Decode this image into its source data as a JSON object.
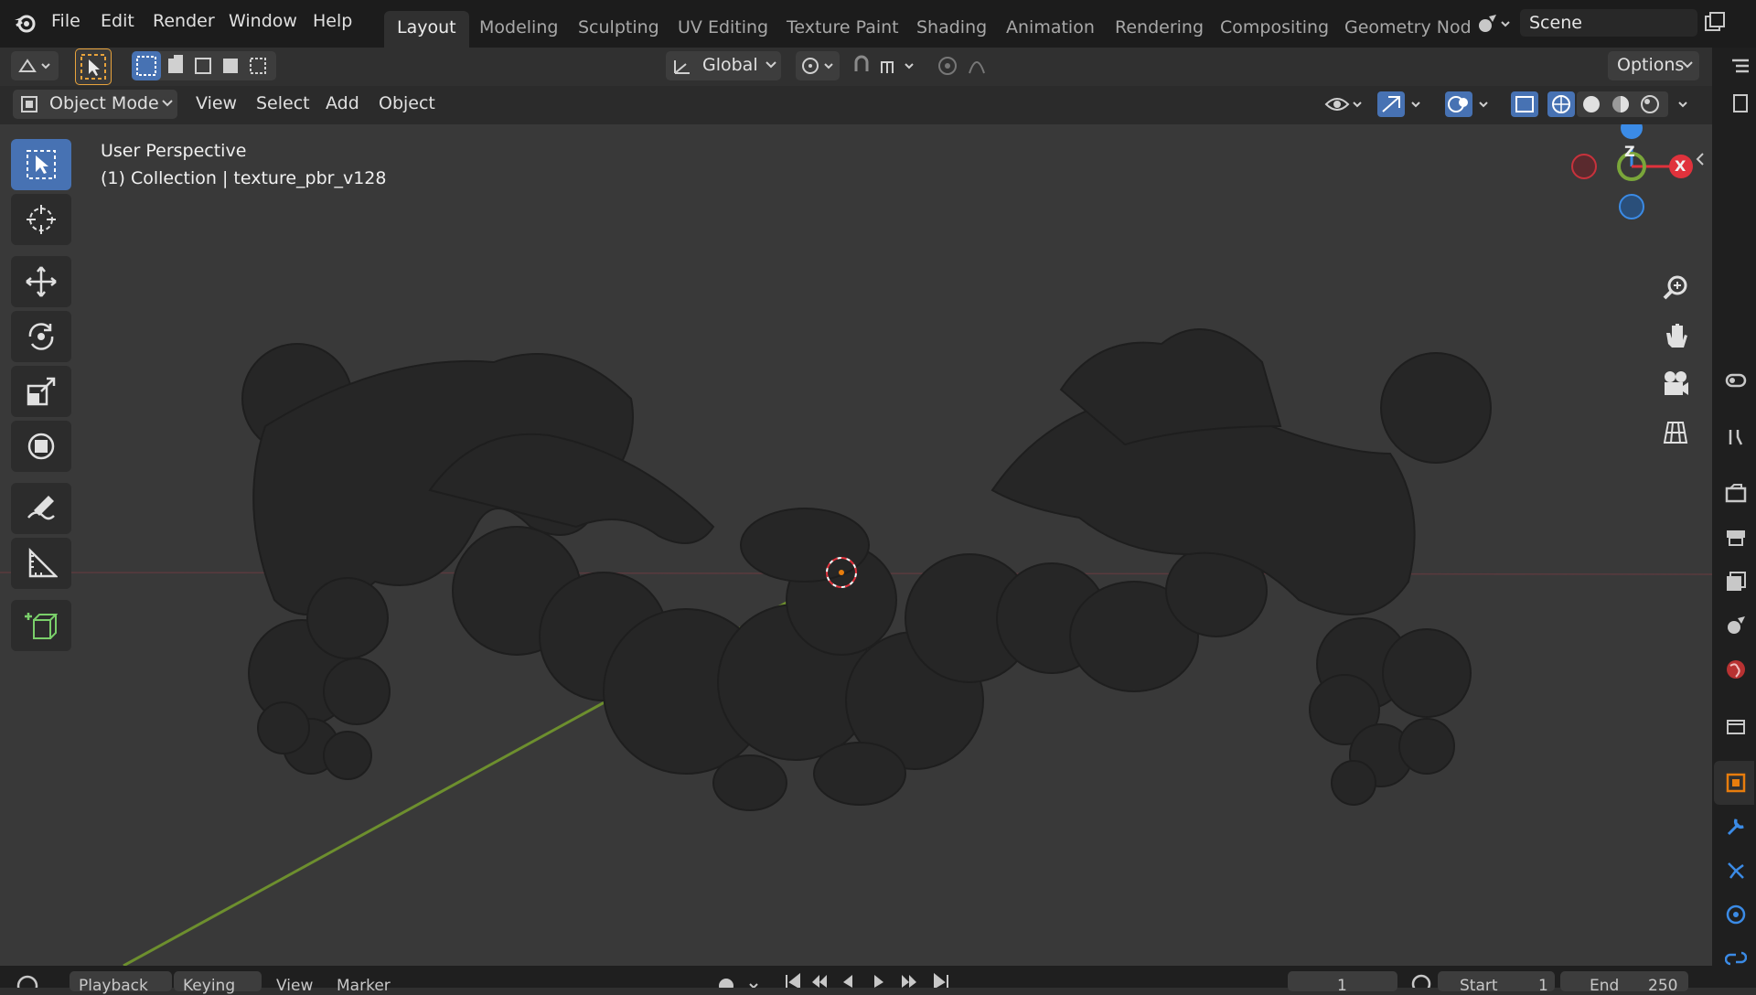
{
  "menu": {
    "items": [
      "File",
      "Edit",
      "Render",
      "Window",
      "Help"
    ]
  },
  "workspaces": {
    "tabs": [
      "Layout",
      "Modeling",
      "Sculpting",
      "UV Editing",
      "Texture Paint",
      "Shading",
      "Animation",
      "Rendering",
      "Compositing",
      "Geometry Nod"
    ],
    "active": "Layout"
  },
  "scene": {
    "name": "Scene"
  },
  "tool_header": {
    "orientation": "Global",
    "options_label": "Options"
  },
  "viewport_header": {
    "mode": "Object Mode",
    "menus": [
      "View",
      "Select",
      "Add",
      "Object"
    ]
  },
  "viewport": {
    "perspective_label": "User Perspective",
    "collection_label": "(1) Collection | texture_pbr_v128",
    "gizmo": {
      "z": "Z",
      "x": "X"
    }
  },
  "timeline": {
    "menus": [
      "Playback",
      "Keying",
      "View",
      "Marker"
    ],
    "current_frame": "1",
    "start_label": "Start",
    "start_value": "1",
    "end_label": "End",
    "end_value": "250"
  },
  "colors": {
    "accent": "#4772b3",
    "x_axis": "#e0323c",
    "y_axis": "#7aa63a",
    "z_axis": "#3b8be6",
    "object_orange": "#e87d0d"
  },
  "icons": {
    "app": "blender-logo-icon",
    "tools": [
      "select-box-icon",
      "cursor-icon",
      "move-icon",
      "rotate-icon",
      "scale-icon",
      "transform-icon",
      "annotate-icon",
      "measure-icon",
      "add-cube-icon"
    ],
    "nav": [
      "zoom-icon",
      "pan-hand-icon",
      "camera-icon",
      "grid-ortho-icon"
    ],
    "properties": [
      "tool-icon",
      "render-icon",
      "output-icon",
      "view-layer-icon",
      "scene-icon",
      "world-icon",
      "collection-icon",
      "object-icon",
      "modifier-icon",
      "particles-icon",
      "physics-icon",
      "constraints-icon"
    ]
  }
}
